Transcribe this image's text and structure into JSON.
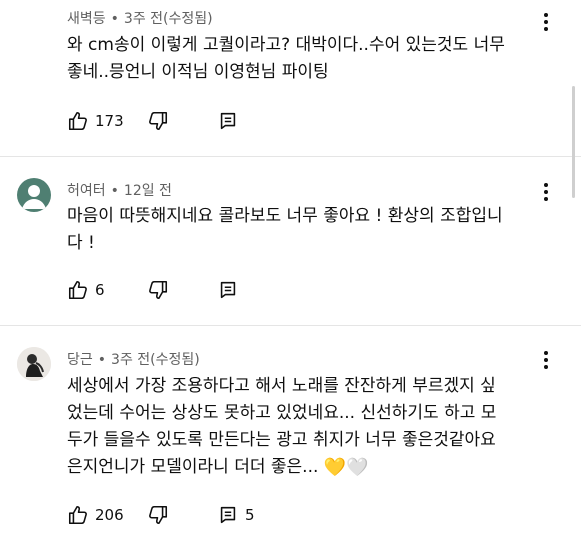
{
  "comments": [
    {
      "author": "새벽등",
      "time": "3주 전(수정됨)",
      "text_lines": [
        "와 cm송이 이렇게 고퀄이라고? 대박이다..수어 있는것도 너무",
        "좋네..믕언니 이적님 이영현님 파이팅"
      ],
      "likes": "173",
      "replies": ""
    },
    {
      "author": "허여터",
      "time": "12일 전",
      "text_lines": [
        "마음이 따뜻해지네요 콜라보도 너무 좋아요 ! 환상의 조합입니",
        "다 !"
      ],
      "likes": "6",
      "replies": ""
    },
    {
      "author": "당근",
      "time": "3주 전(수정됨)",
      "text_lines": [
        "세상에서 가장 조용하다고 해서 노래를 잔잔하게 부르겠지 싶",
        "었는데 수어는 상상도 못하고 있었네요... 신선하기도 하고 모",
        "두가 들을수 있도록 만든다는 광고 취지가 너무 좋은것같아요",
        "은지언니가 모델이라니 더더 좋은..."
      ],
      "emojis": "💛🤍",
      "likes": "206",
      "replies": "5"
    }
  ],
  "colors": {
    "text": "#0f0f0f",
    "meta": "#606060",
    "divider": "#e5e5e5",
    "avatar_teal": "#4f7f72"
  },
  "icons": {
    "like": "thumbs-up-icon",
    "dislike": "thumbs-down-icon",
    "reply": "reply-comment-icon",
    "menu": "kebab-menu-icon"
  }
}
